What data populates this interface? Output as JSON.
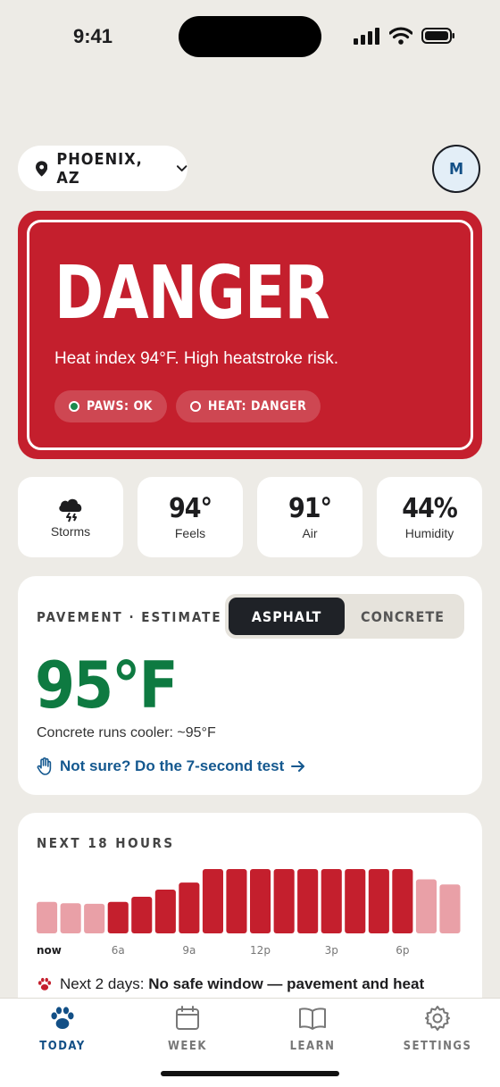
{
  "status": {
    "time": "9:41"
  },
  "header": {
    "location": "PHOENIX, AZ",
    "avatar_initial": "M"
  },
  "alert": {
    "level": "DANGER",
    "description": "Heat index 94°F. High heatstroke risk.",
    "chips": [
      {
        "label": "PAWS: OK",
        "status": "ok"
      },
      {
        "label": "HEAT: DANGER",
        "status": "danger"
      }
    ],
    "color": "#c41f2d"
  },
  "stats": [
    {
      "icon": "storm-cloud-icon",
      "value": "",
      "label": "Storms"
    },
    {
      "icon": "",
      "value": "94°",
      "label": "Feels"
    },
    {
      "icon": "",
      "value": "91°",
      "label": "Air"
    },
    {
      "icon": "",
      "value": "44%",
      "label": "Humidity"
    }
  ],
  "pavement": {
    "title": "PAVEMENT · ESTIMATE",
    "segments": [
      "ASPHALT",
      "CONCRETE"
    ],
    "selected": "ASPHALT",
    "temperature": "95°F",
    "note": "Concrete runs cooler: ~95°F",
    "link": "Not sure? Do the 7-second test",
    "temp_color": "#0e7a41"
  },
  "hourly": {
    "title": "NEXT 18 HOURS",
    "tick_labels": [
      "now",
      "6a",
      "9a",
      "12p",
      "3p",
      "6p"
    ],
    "forecast_prefix": "Next 2 days: ",
    "forecast_bold": "No safe window — pavement and heat"
  },
  "chart_data": {
    "type": "bar",
    "categories": [
      "now",
      "",
      "",
      "6a",
      "",
      "",
      "9a",
      "",
      "",
      "12p",
      "",
      "",
      "3p",
      "",
      "",
      "6p",
      "",
      ""
    ],
    "values": [
      0.49,
      0.47,
      0.46,
      0.49,
      0.57,
      0.68,
      0.79,
      1.0,
      1.0,
      1.0,
      1.0,
      1.0,
      1.0,
      1.0,
      1.0,
      1.0,
      0.84,
      0.76
    ],
    "risk": [
      "caution",
      "caution",
      "caution",
      "danger",
      "danger",
      "danger",
      "danger",
      "danger",
      "danger",
      "danger",
      "danger",
      "danger",
      "danger",
      "danger",
      "danger",
      "danger",
      "caution",
      "caution"
    ],
    "colors": {
      "danger": "#c41f2d",
      "caution": "#e9a0a7"
    },
    "title": "NEXT 18 HOURS",
    "xlabel": "",
    "ylabel": "",
    "ylim": [
      0,
      1
    ]
  },
  "tabs": [
    {
      "label": "TODAY",
      "icon": "paw-icon",
      "active": true
    },
    {
      "label": "WEEK",
      "icon": "calendar-icon",
      "active": false
    },
    {
      "label": "LEARN",
      "icon": "book-icon",
      "active": false
    },
    {
      "label": "SETTINGS",
      "icon": "gear-icon",
      "active": false
    }
  ]
}
